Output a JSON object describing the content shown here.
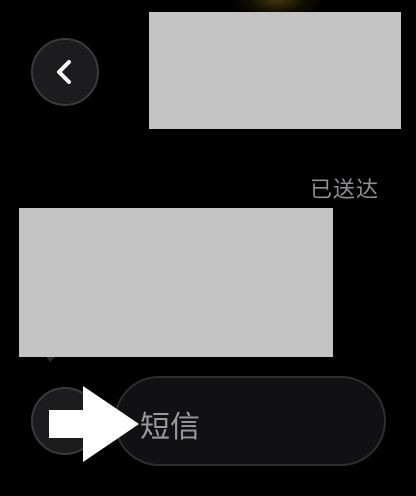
{
  "header": {
    "back_icon": "chevron-left-icon"
  },
  "conversation": {
    "delivered_status": "已送达"
  },
  "composer": {
    "placeholder": "短信",
    "aux_icon": "add-icon"
  },
  "overlay": {
    "pointer_icon": "arrow-right-icon"
  },
  "colors": {
    "background": "#000000",
    "bubble_placeholder": "#c4c4c4",
    "button_fill": "#1c1c1e",
    "secondary_text": "#8e8e93",
    "pointer": "#ffffff"
  }
}
